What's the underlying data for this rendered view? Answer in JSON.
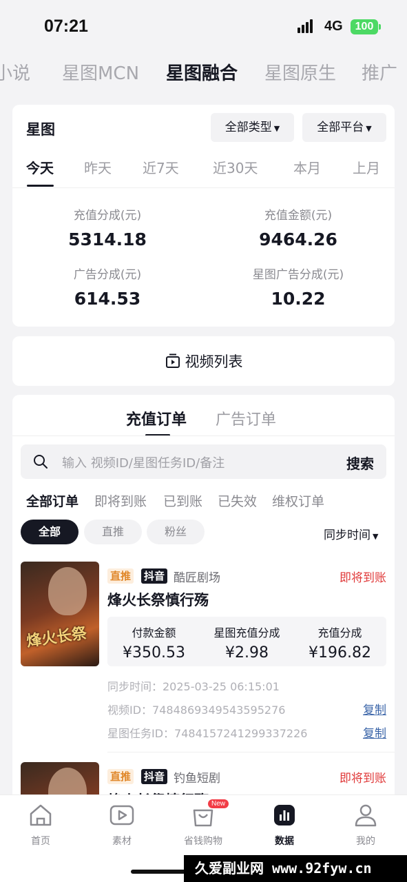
{
  "status_bar": {
    "time": "07:21",
    "network": "4G",
    "battery": "100"
  },
  "top_tabs": [
    "小说",
    "星图MCN",
    "星图融合",
    "星图原生",
    "推广"
  ],
  "summary": {
    "title": "星图",
    "filter_type": "全部类型",
    "filter_platform": "全部平台",
    "date_tabs": [
      "今天",
      "昨天",
      "近7天",
      "近30天",
      "本月",
      "上月"
    ],
    "metrics": [
      {
        "label": "充值分成(元)",
        "value": "5314.18"
      },
      {
        "label": "充值金额(元)",
        "value": "9464.26"
      },
      {
        "label": "广告分成(元)",
        "value": "614.53"
      },
      {
        "label": "星图广告分成(元)",
        "value": "10.22"
      }
    ]
  },
  "video_list_label": "视频列表",
  "orders": {
    "tabs": [
      "充值订单",
      "广告订单"
    ],
    "search_placeholder": "输入 视频ID/星图任务ID/备注",
    "search_button": "搜索",
    "filter_tabs": [
      "全部订单",
      "即将到账",
      "已到账",
      "已失效",
      "维权订单"
    ],
    "pills": [
      "全部",
      "直推",
      "粉丝"
    ],
    "sort_label": "同步时间",
    "items": [
      {
        "badge_type": "直推",
        "badge_platform": "抖音",
        "studio": "酷匠剧场",
        "status": "即将到账",
        "title": "烽火长祭慎行殇",
        "poster_text": "烽火长祭",
        "amount_labels": [
          "付款金额",
          "星图充值分成",
          "充值分成"
        ],
        "amount_values": [
          "¥350.53",
          "¥2.98",
          "¥196.82"
        ],
        "sync_time": "同步时间：2025-03-25 06:15:01",
        "video_id": "视频ID：7484869349543595276",
        "task_id": "星图任务ID：7484157241299337226",
        "copy_label": "复制"
      },
      {
        "badge_type": "直推",
        "badge_platform": "抖音",
        "studio": "钓鱼短剧",
        "status": "即将到账",
        "title": "烽火长祭慎行殇"
      }
    ]
  },
  "bottom_nav": [
    {
      "label": "首页",
      "icon": "home-icon"
    },
    {
      "label": "素材",
      "icon": "play-icon"
    },
    {
      "label": "省钱购物",
      "icon": "shopping-bag-icon",
      "badge": "New"
    },
    {
      "label": "数据",
      "icon": "bar-chart-icon"
    },
    {
      "label": "我的",
      "icon": "person-icon"
    }
  ],
  "watermark": "久爱副业网 www.92fyw.cn",
  "colors": {
    "accent_red": "#e03a3a",
    "link_blue": "#3a64a8",
    "badge_orange": "#e0872a",
    "battery_green": "#4cd964"
  }
}
